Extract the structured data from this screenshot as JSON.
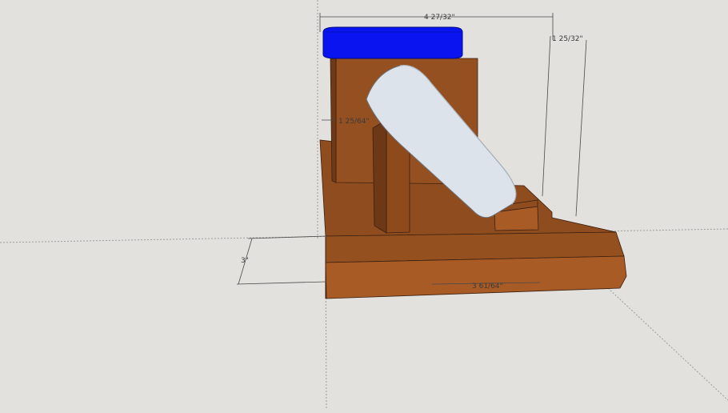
{
  "viewport": {
    "background": "#e2e1de",
    "axis_color": "#9c9c9c",
    "dimension_color": "#4a4a4a"
  },
  "model": {
    "wood_color_top": "#8f4d1f",
    "wood_color_front": "#a85b25",
    "wood_color_side": "#6f3a17",
    "blue_disc_color": "#0a14f0",
    "wheel_color": "#dde3ea",
    "wheel_edge_color": "#aeb5bd"
  },
  "dimensions": {
    "overall_width": "4 27/32\"",
    "overall_height": "1 25/32\"",
    "block_depth": "1 25/64\"",
    "base_height": "3\"",
    "base_width": "3 61/64\""
  }
}
